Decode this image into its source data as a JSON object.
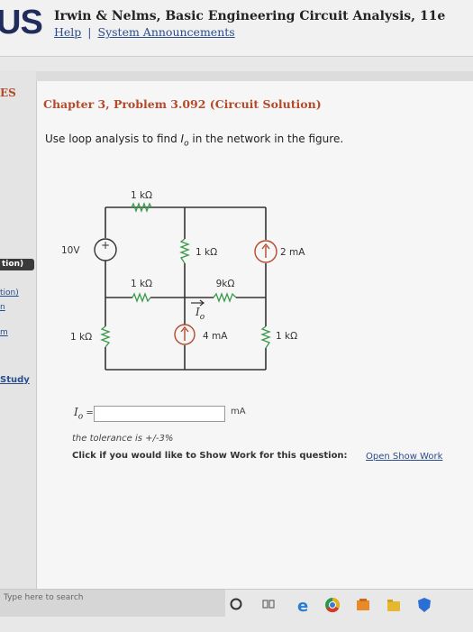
{
  "header": {
    "logo": "US",
    "book_title": "Irwin & Nelms, Basic Engineering Circuit Analysis, 11e",
    "help_link": "Help",
    "separator": "|",
    "announcements_link": "System Announcements"
  },
  "sidebar": {
    "section_label": "ES",
    "tab_label": "tion)",
    "item_1": "tion)",
    "item_2": "n",
    "item_3": "m",
    "study_link": "Study"
  },
  "problem": {
    "chapter_title": "Chapter 3, Problem 3.092 (Circuit Solution)",
    "question_prefix": "Use loop analysis to find ",
    "question_var": "I",
    "question_sub": "o",
    "question_suffix": " in the network in the figure."
  },
  "circuit": {
    "top_resistor": "1 kΩ",
    "voltage_source": "10V",
    "plus_sign": "+",
    "middle_resistor": "1 kΩ",
    "right_current_source": "2 mA",
    "inner_left_resistor": "1 kΩ",
    "inner_right_resistor": "9kΩ",
    "io_symbol": "I",
    "io_sub": "o",
    "left_resistor": "1 kΩ",
    "center_current_source": "4 mA",
    "right_resistor": "1 kΩ"
  },
  "answer": {
    "label_var": "I",
    "label_sub": "o",
    "label_eq": " =",
    "value": "",
    "unit": "mA",
    "tolerance_text": "the tolerance is +/-3%",
    "show_work_text": "Click if you would like to Show Work for this question:",
    "show_work_link": "Open Show Work"
  },
  "taskbar": {
    "search_placeholder": "Type here to search"
  },
  "colors": {
    "header_blue": "#1f2c5c",
    "chapter_red": "#b34a2a",
    "link_blue": "#2b4d8c",
    "resistor_green": "#3a9a4a"
  }
}
